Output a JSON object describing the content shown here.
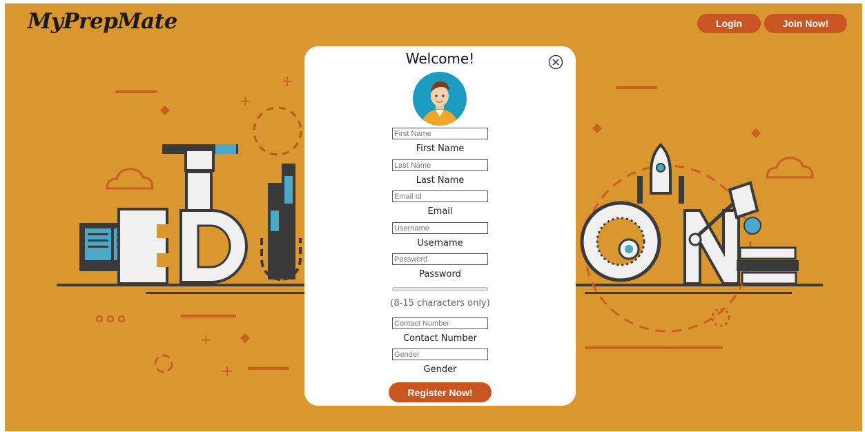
{
  "header": {
    "logo": "MyPrepMate",
    "login_label": "Login",
    "join_label": "Join Now!"
  },
  "background": {
    "letters": "EDUCATION"
  },
  "modal": {
    "title": "Welcome!",
    "fields": [
      {
        "placeholder": "First Name",
        "label": "First Name"
      },
      {
        "placeholder": "Last Name",
        "label": "Last Name"
      },
      {
        "placeholder": "Email Id",
        "label": "Email"
      },
      {
        "placeholder": "Username",
        "label": "Username"
      },
      {
        "placeholder": "Password",
        "label": "Password"
      },
      {
        "placeholder": "Contact Number",
        "label": "Contact Number"
      },
      {
        "placeholder": "Gender",
        "label": "Gender"
      }
    ],
    "password_hint": "(8-15 characters only)",
    "register_label": "Register Now!"
  },
  "colors": {
    "background": "#da962f",
    "accent": "#c95522",
    "card": "#ffffff"
  }
}
